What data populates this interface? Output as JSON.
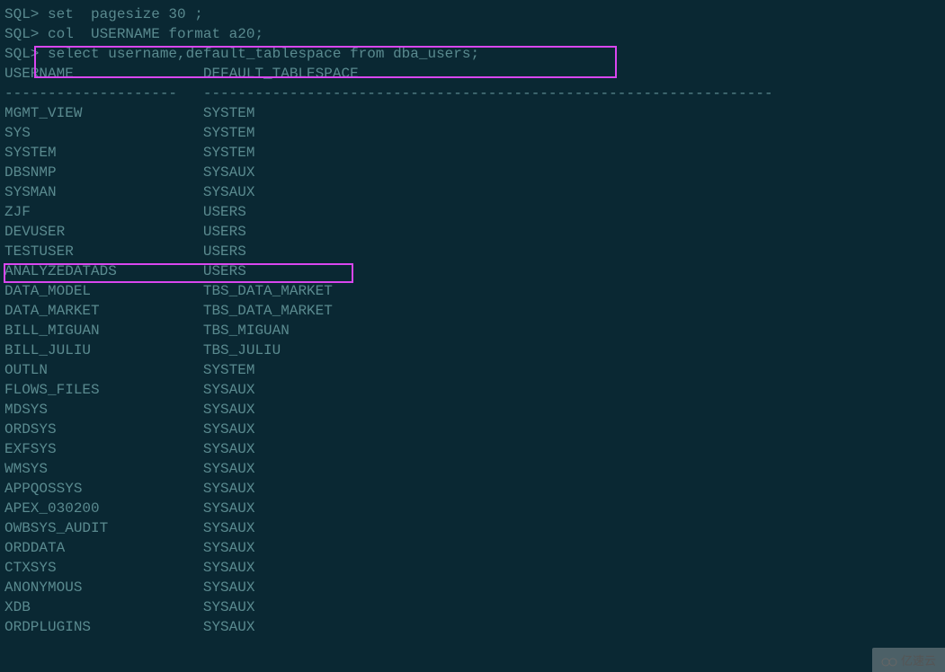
{
  "prompt": "SQL> ",
  "commands": [
    "set  pagesize 30 ;",
    "col  USERNAME format a20;",
    "select username,default_tablespace from dba_users;"
  ],
  "headers": {
    "col1": "USERNAME",
    "col2": "DEFAULT_TABLESPACE"
  },
  "divider1": "--------------------",
  "divider2": "------------------------------------------------------------------",
  "rows": [
    {
      "u": "MGMT_VIEW",
      "t": "SYSTEM"
    },
    {
      "u": "SYS",
      "t": "SYSTEM"
    },
    {
      "u": "SYSTEM",
      "t": "SYSTEM"
    },
    {
      "u": "DBSNMP",
      "t": "SYSAUX"
    },
    {
      "u": "SYSMAN",
      "t": "SYSAUX"
    },
    {
      "u": "ZJF",
      "t": "USERS"
    },
    {
      "u": "DEVUSER",
      "t": "USERS"
    },
    {
      "u": "TESTUSER",
      "t": "USERS"
    },
    {
      "u": "ANALYZEDATADS",
      "t": "USERS"
    },
    {
      "u": "DATA_MODEL",
      "t": "TBS_DATA_MARKET"
    },
    {
      "u": "DATA_MARKET",
      "t": "TBS_DATA_MARKET"
    },
    {
      "u": "BILL_MIGUAN",
      "t": "TBS_MIGUAN"
    },
    {
      "u": "BILL_JULIU",
      "t": "TBS_JULIU"
    },
    {
      "u": "OUTLN",
      "t": "SYSTEM"
    },
    {
      "u": "FLOWS_FILES",
      "t": "SYSAUX"
    },
    {
      "u": "MDSYS",
      "t": "SYSAUX"
    },
    {
      "u": "ORDSYS",
      "t": "SYSAUX"
    },
    {
      "u": "EXFSYS",
      "t": "SYSAUX"
    },
    {
      "u": "WMSYS",
      "t": "SYSAUX"
    },
    {
      "u": "APPQOSSYS",
      "t": "SYSAUX"
    },
    {
      "u": "APEX_030200",
      "t": "SYSAUX"
    },
    {
      "u": "OWBSYS_AUDIT",
      "t": "SYSAUX"
    },
    {
      "u": "ORDDATA",
      "t": "SYSAUX"
    },
    {
      "u": "CTXSYS",
      "t": "SYSAUX"
    },
    {
      "u": "ANONYMOUS",
      "t": "SYSAUX"
    },
    {
      "u": "XDB",
      "t": "SYSAUX"
    },
    {
      "u": "ORDPLUGINS",
      "t": "SYSAUX"
    }
  ],
  "col1_width": 23,
  "watermark": "亿速云"
}
